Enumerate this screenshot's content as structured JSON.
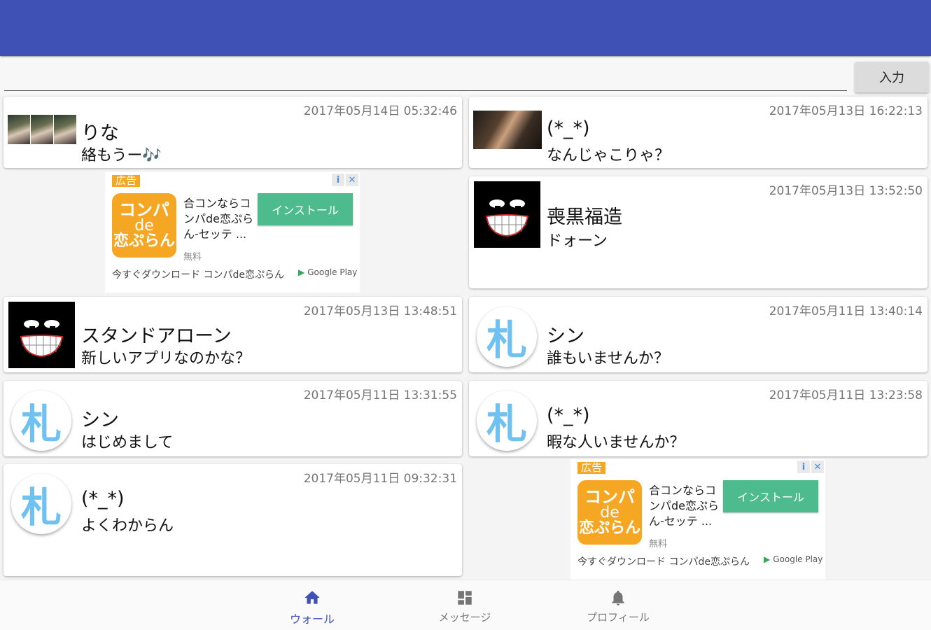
{
  "input": {
    "value": "",
    "placeholder": "",
    "submit_label": "入力"
  },
  "posts": [
    {
      "name": "りな",
      "message": "絡もうー🎶",
      "timestamp": "2017年05月14日 05:32:46",
      "avatar": "photo-triple"
    },
    {
      "name": "(*_*)",
      "message": "なんじゃこりゃ？",
      "timestamp": "2017年05月13日 16:22:13",
      "avatar": "photo"
    },
    {
      "name": "喪黒福造",
      "message": "ドォーン",
      "timestamp": "2017年05月13日 13:52:50",
      "avatar": "grin-face"
    },
    {
      "name": "スタンドアローン",
      "message": "新しいアプリなのかな？",
      "timestamp": "2017年05月13日 13:48:51",
      "avatar": "grin-face"
    },
    {
      "name": "シン",
      "message": "誰もいませんか？",
      "timestamp": "2017年05月11日 13:40:14",
      "avatar": "fuda"
    },
    {
      "name": "シン",
      "message": "はじめまして",
      "timestamp": "2017年05月11日 13:31:55",
      "avatar": "fuda"
    },
    {
      "name": "(*_*)",
      "message": "暇な人いませんか？",
      "timestamp": "2017年05月11日 13:23:58",
      "avatar": "fuda"
    },
    {
      "name": "(*_*)",
      "message": "よくわからん",
      "timestamp": "2017年05月11日 09:32:31",
      "avatar": "fuda"
    }
  ],
  "avatar_glyph": "札",
  "ad": {
    "badge": "広告",
    "info": "i",
    "close": "✕",
    "app_icon": {
      "line1": "コンパ",
      "line2": "de",
      "line3": "恋ぷらん"
    },
    "description": "合コンならコンパde恋ぷらん-セッテ ...",
    "price": "無料",
    "install_label": "インストール",
    "download_text": "今すぐダウンロード コンパde恋ぷらん",
    "store_label": "Google Play"
  },
  "nav": [
    {
      "label": "ウォール",
      "icon": "home-icon",
      "active": true
    },
    {
      "label": "メッセージ",
      "icon": "dashboard-icon",
      "active": false
    },
    {
      "label": "プロフィール",
      "icon": "bell-icon",
      "active": false
    }
  ],
  "colors": {
    "appbar": "#3f51b5",
    "accent": "#3f51b5",
    "install": "#4dbb8d",
    "ad_badge": "#f5a623",
    "avatar_glyph": "#6ec1f0"
  }
}
